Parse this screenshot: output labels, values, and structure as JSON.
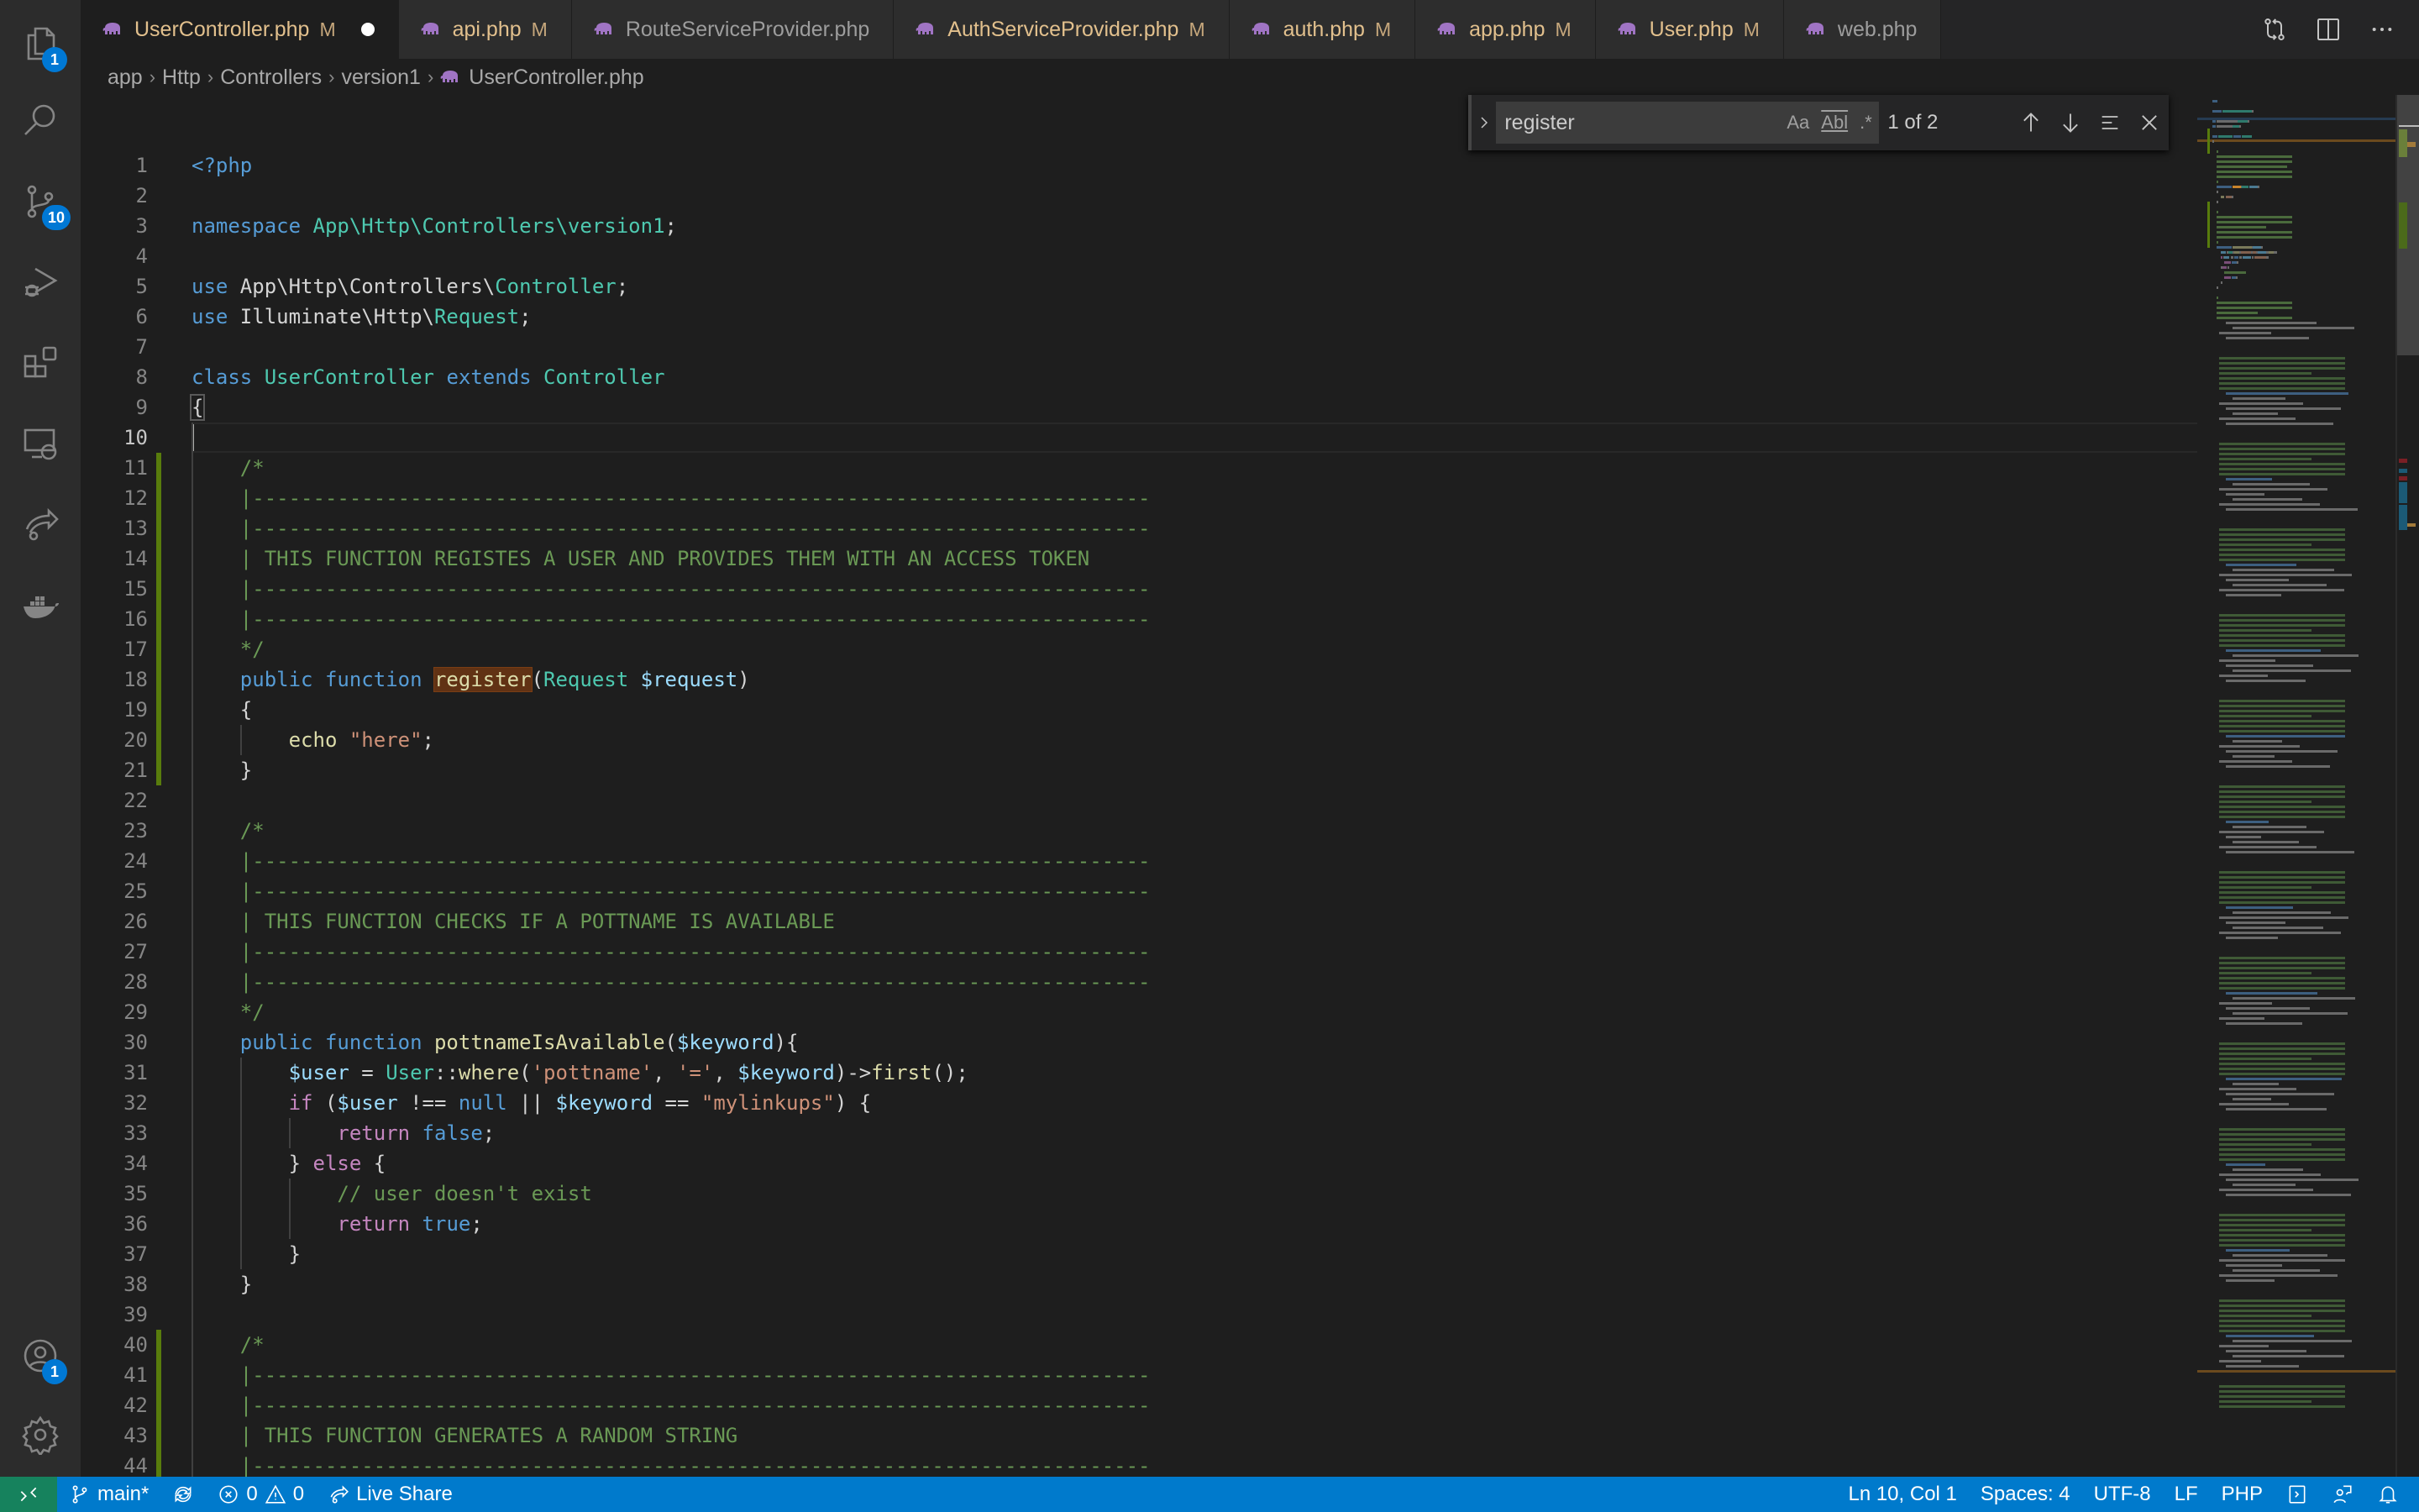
{
  "activity_bar": {
    "items": [
      {
        "name": "explorer",
        "icon": "files-icon",
        "badge": "1"
      },
      {
        "name": "search",
        "icon": "search-icon",
        "badge": null
      },
      {
        "name": "source-control",
        "icon": "source-control-icon",
        "badge": "10"
      },
      {
        "name": "run-debug",
        "icon": "run-debug-icon",
        "badge": null
      },
      {
        "name": "extensions",
        "icon": "extensions-icon",
        "badge": null
      },
      {
        "name": "remote-explorer",
        "icon": "remote-explorer-icon",
        "badge": null
      },
      {
        "name": "live-share",
        "icon": "live-share-icon",
        "badge": null
      },
      {
        "name": "docker",
        "icon": "docker-icon",
        "badge": null
      }
    ],
    "bottom": [
      {
        "name": "accounts",
        "icon": "account-icon",
        "badge": "1"
      },
      {
        "name": "manage",
        "icon": "gear-icon",
        "badge": null
      }
    ]
  },
  "tabs": [
    {
      "label": "UserController.php",
      "modified": "M",
      "active": true,
      "dirty": true
    },
    {
      "label": "api.php",
      "modified": "M",
      "active": false
    },
    {
      "label": "RouteServiceProvider.php",
      "modified": "",
      "active": false
    },
    {
      "label": "AuthServiceProvider.php",
      "modified": "M",
      "active": false
    },
    {
      "label": "auth.php",
      "modified": "M",
      "active": false
    },
    {
      "label": "app.php",
      "modified": "M",
      "active": false
    },
    {
      "label": "User.php",
      "modified": "M",
      "active": false
    },
    {
      "label": "web.php",
      "modified": "",
      "active": false
    }
  ],
  "breadcrumb": [
    "app",
    "Http",
    "Controllers",
    "version1",
    "UserController.php"
  ],
  "find": {
    "query": "register",
    "match_case_label": "Aa",
    "whole_word_label": "Abl",
    "regex_label": ".*",
    "count": "1 of 2"
  },
  "editor": {
    "current_line": 10,
    "modified_lines": [
      11,
      12,
      13,
      14,
      15,
      16,
      17,
      18,
      19,
      20,
      21,
      40,
      41,
      42,
      43,
      44
    ],
    "lines": [
      [
        [
          "k",
          "<?php"
        ]
      ],
      [],
      [
        [
          "k",
          "namespace "
        ],
        [
          "t",
          "App\\Http\\Controllers\\version1"
        ],
        [
          "",
          "; "
        ]
      ],
      [],
      [
        [
          "k",
          "use "
        ],
        [
          "",
          "App\\Http\\Controllers\\"
        ],
        [
          "t",
          "Controller"
        ],
        [
          "",
          ";"
        ]
      ],
      [
        [
          "k",
          "use "
        ],
        [
          "",
          "Illuminate\\Http\\"
        ],
        [
          "t",
          "Request"
        ],
        [
          "",
          ";"
        ]
      ],
      [],
      [
        [
          "k",
          "class "
        ],
        [
          "t",
          "UserController "
        ],
        [
          "k",
          "extends "
        ],
        [
          "t",
          "Controller"
        ]
      ],
      [
        [
          "bb",
          "{"
        ]
      ],
      [],
      [
        [
          "",
          "    "
        ],
        [
          "c",
          "/*"
        ]
      ],
      [
        [
          "",
          "    "
        ],
        [
          "c",
          "|--------------------------------------------------------------------------"
        ]
      ],
      [
        [
          "",
          "    "
        ],
        [
          "c",
          "|--------------------------------------------------------------------------"
        ]
      ],
      [
        [
          "",
          "    "
        ],
        [
          "c",
          "| THIS FUNCTION REGISTES A USER AND PROVIDES THEM WITH AN ACCESS TOKEN"
        ]
      ],
      [
        [
          "",
          "    "
        ],
        [
          "c",
          "|--------------------------------------------------------------------------"
        ]
      ],
      [
        [
          "",
          "    "
        ],
        [
          "c",
          "|--------------------------------------------------------------------------"
        ]
      ],
      [
        [
          "",
          "    "
        ],
        [
          "c",
          "*/"
        ]
      ],
      [
        [
          "",
          "    "
        ],
        [
          "k",
          "public function "
        ],
        [
          "fm",
          "register"
        ],
        [
          "",
          "("
        ],
        [
          "t",
          "Request "
        ],
        [
          "v",
          "$request"
        ],
        [
          "",
          ")"
        ]
      ],
      [
        [
          "",
          "    {"
        ]
      ],
      [
        [
          "",
          "        "
        ],
        [
          "f",
          "echo "
        ],
        [
          "s",
          "\"here\""
        ],
        [
          "",
          ";"
        ]
      ],
      [
        [
          "",
          "    }"
        ]
      ],
      [],
      [
        [
          "",
          "    "
        ],
        [
          "c",
          "/*"
        ]
      ],
      [
        [
          "",
          "    "
        ],
        [
          "c",
          "|--------------------------------------------------------------------------"
        ]
      ],
      [
        [
          "",
          "    "
        ],
        [
          "c",
          "|--------------------------------------------------------------------------"
        ]
      ],
      [
        [
          "",
          "    "
        ],
        [
          "c",
          "| THIS FUNCTION CHECKS IF A POTTNAME IS AVAILABLE"
        ]
      ],
      [
        [
          "",
          "    "
        ],
        [
          "c",
          "|--------------------------------------------------------------------------"
        ]
      ],
      [
        [
          "",
          "    "
        ],
        [
          "c",
          "|--------------------------------------------------------------------------"
        ]
      ],
      [
        [
          "",
          "    "
        ],
        [
          "c",
          "*/"
        ]
      ],
      [
        [
          "",
          "    "
        ],
        [
          "k",
          "public function "
        ],
        [
          "f",
          "pottnameIsAvailable"
        ],
        [
          "",
          "("
        ],
        [
          "v",
          "$keyword"
        ],
        [
          "",
          "){"
        ]
      ],
      [
        [
          "",
          "        "
        ],
        [
          "v",
          "$user"
        ],
        [
          "",
          " = "
        ],
        [
          "t",
          "User"
        ],
        [
          "",
          "::"
        ],
        [
          "f",
          "where"
        ],
        [
          "",
          "("
        ],
        [
          "s",
          "'pottname'"
        ],
        [
          "",
          ", "
        ],
        [
          "s",
          "'='"
        ],
        [
          "",
          ", "
        ],
        [
          "v",
          "$keyword"
        ],
        [
          "",
          ")->"
        ],
        [
          "f",
          "first"
        ],
        [
          "",
          "();"
        ]
      ],
      [
        [
          "",
          "        "
        ],
        [
          "p",
          "if "
        ],
        [
          "",
          "("
        ],
        [
          "v",
          "$user"
        ],
        [
          "",
          " !== "
        ],
        [
          "k",
          "null"
        ],
        [
          "",
          " || "
        ],
        [
          "v",
          "$keyword"
        ],
        [
          "",
          " == "
        ],
        [
          "s",
          "\"mylinkups\""
        ],
        [
          "",
          ") {"
        ]
      ],
      [
        [
          "",
          "            "
        ],
        [
          "p",
          "return "
        ],
        [
          "k",
          "false"
        ],
        [
          "",
          ";"
        ]
      ],
      [
        [
          "",
          "        } "
        ],
        [
          "p",
          "else"
        ],
        [
          "",
          " {"
        ]
      ],
      [
        [
          "",
          "            "
        ],
        [
          "c",
          "// user doesn't exist"
        ]
      ],
      [
        [
          "",
          "            "
        ],
        [
          "p",
          "return "
        ],
        [
          "k",
          "true"
        ],
        [
          "",
          ";"
        ]
      ],
      [
        [
          "",
          "        }"
        ]
      ],
      [
        [
          "",
          "    }"
        ]
      ],
      [],
      [
        [
          "",
          "    "
        ],
        [
          "c",
          "/*"
        ]
      ],
      [
        [
          "",
          "    "
        ],
        [
          "c",
          "|--------------------------------------------------------------------------"
        ]
      ],
      [
        [
          "",
          "    "
        ],
        [
          "c",
          "|--------------------------------------------------------------------------"
        ]
      ],
      [
        [
          "",
          "    "
        ],
        [
          "c",
          "| THIS FUNCTION GENERATES A RANDOM STRING"
        ]
      ],
      [
        [
          "",
          "    "
        ],
        [
          "c",
          "|--------------------------------------------------------------------------"
        ]
      ]
    ]
  },
  "status_bar": {
    "branch": "main*",
    "errors": "0",
    "warnings": "0",
    "live_share": "Live Share",
    "position": "Ln 10, Col 1",
    "spaces": "Spaces: 4",
    "encoding": "UTF-8",
    "eol": "LF",
    "language": "PHP"
  },
  "colors": {
    "accent": "#007acc",
    "remote": "#16825d",
    "badge": "#0078d4",
    "modified_tab": "#e2c08d",
    "find_match": "#613214"
  }
}
